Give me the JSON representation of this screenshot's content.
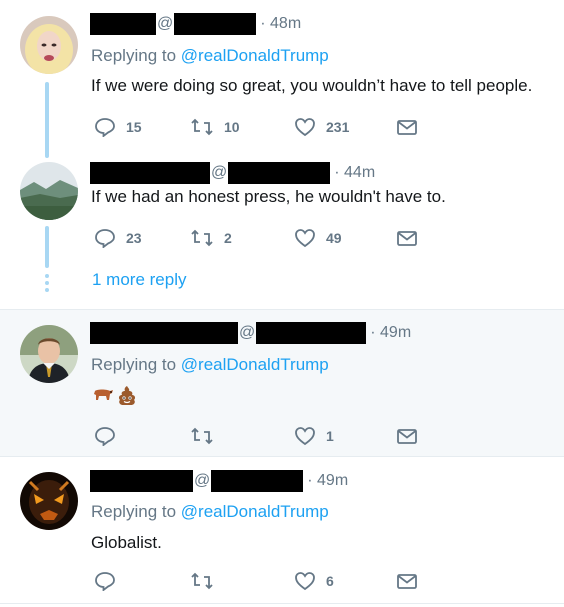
{
  "colors": {
    "link": "#1da1f2",
    "muted": "#657786",
    "text": "#14171a",
    "thread": "#a8d7f3",
    "highlight_bg": "#f5f8fa"
  },
  "thread": {
    "tweet1": {
      "handle_at": "@",
      "time": "· 48m",
      "replying_prefix": "Replying to",
      "replying_handle": "@realDonaldTrump",
      "text": "If we were doing so great, you wouldn’t have to tell people.",
      "reply_count": "15",
      "retweet_count": "10",
      "like_count": "231"
    },
    "tweet2": {
      "handle_at": "@",
      "time": "· 44m",
      "text": "If we had an honest press, he wouldn't have to.",
      "reply_count": "23",
      "retweet_count": "2",
      "like_count": "49"
    },
    "more_replies": "1 more reply"
  },
  "tweet3": {
    "handle_at": "@",
    "time": "· 49m",
    "replying_prefix": "Replying to",
    "replying_handle": "@realDonaldTrump",
    "emojis": [
      "ox",
      "pile-of-poo"
    ],
    "reply_count": "",
    "retweet_count": "",
    "like_count": "1"
  },
  "tweet4": {
    "handle_at": "@",
    "time": "· 49m",
    "replying_prefix": "Replying to",
    "replying_handle": "@realDonaldTrump",
    "text": "Globalist.",
    "reply_count": "",
    "retweet_count": "",
    "like_count": "6"
  }
}
